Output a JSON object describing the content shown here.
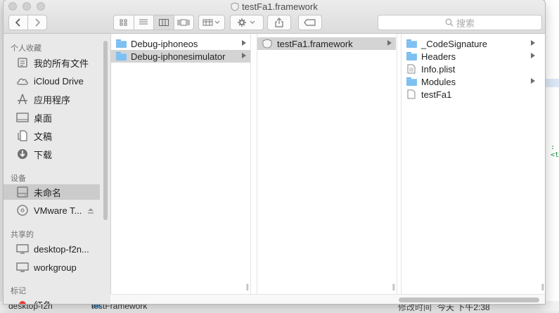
{
  "window": {
    "title": "testFa1.framework"
  },
  "toolbar": {
    "search_placeholder": "搜索"
  },
  "sidebar": {
    "sections": [
      {
        "header": "个人收藏",
        "items": [
          {
            "label": "我的所有文件",
            "icon": "all-files-icon"
          },
          {
            "label": "iCloud Drive",
            "icon": "cloud-icon"
          },
          {
            "label": "应用程序",
            "icon": "applications-icon"
          },
          {
            "label": "桌面",
            "icon": "desktop-icon"
          },
          {
            "label": "文稿",
            "icon": "documents-icon"
          },
          {
            "label": "下载",
            "icon": "download-icon"
          }
        ]
      },
      {
        "header": "设备",
        "items": [
          {
            "label": "未命名",
            "icon": "drive-icon",
            "selected": true
          },
          {
            "label": "VMware T...",
            "icon": "disc-icon"
          }
        ]
      },
      {
        "header": "共享的",
        "items": [
          {
            "label": "desktop-f2n...",
            "icon": "computer-icon"
          },
          {
            "label": "workgroup",
            "icon": "computer-icon"
          }
        ]
      },
      {
        "header": "标记",
        "items": [
          {
            "label": "红色",
            "icon": "red-tag-icon"
          }
        ]
      }
    ]
  },
  "columns": [
    {
      "items": [
        {
          "label": "Debug-iphoneos",
          "icon": "folder-icon",
          "has_children": true
        },
        {
          "label": "Debug-iphonesimulator",
          "icon": "folder-icon",
          "has_children": true,
          "selected": true
        }
      ]
    },
    {
      "items": [
        {
          "label": "testFa1.framework",
          "icon": "framework-icon",
          "has_children": true,
          "selected": true
        }
      ]
    },
    {
      "items": [
        {
          "label": "_CodeSignature",
          "icon": "folder-icon",
          "has_children": true
        },
        {
          "label": "Headers",
          "icon": "folder-icon",
          "has_children": true
        },
        {
          "label": "Info.plist",
          "icon": "plist-file-icon",
          "has_children": false
        },
        {
          "label": "Modules",
          "icon": "folder-icon",
          "has_children": true
        },
        {
          "label": "testFa1",
          "icon": "file-icon",
          "has_children": false
        }
      ]
    }
  ],
  "background": {
    "code_fragment": ": <t",
    "bottom_left": "desktop-f2n",
    "bottom_item": "testFramework",
    "bottom_modified_label": "修改时间",
    "bottom_modified_value": "今天 下午2:38"
  },
  "colors": {
    "folder": "#7ec0f2",
    "selection": "#d4d4d4",
    "sidebar_bg": "#e9e9e9"
  }
}
